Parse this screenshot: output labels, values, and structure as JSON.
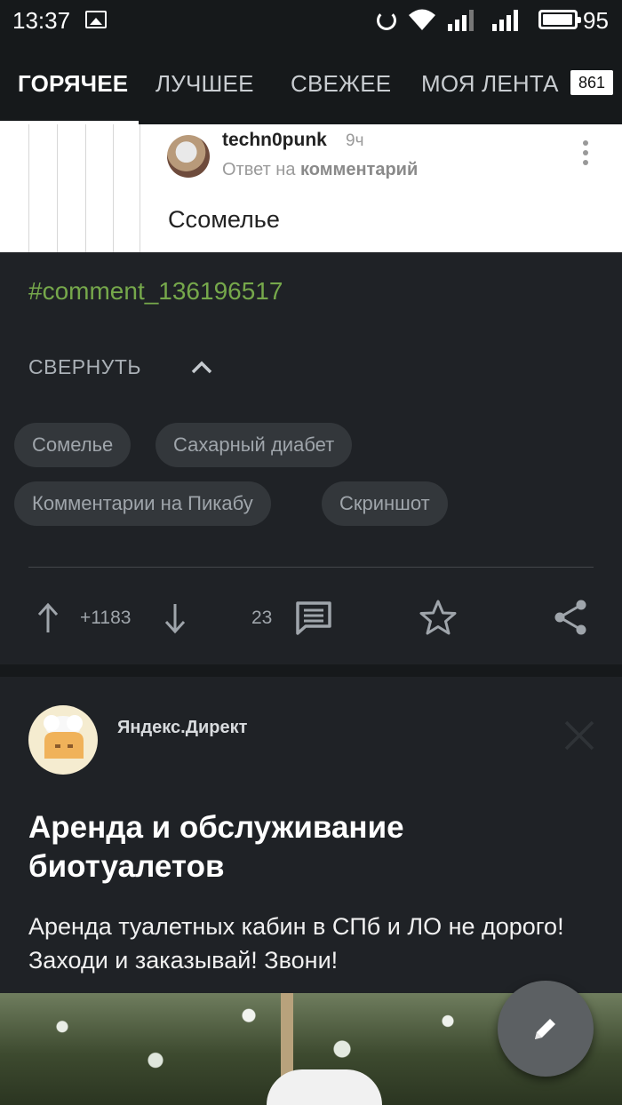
{
  "status_bar": {
    "time": "13:37",
    "battery_percent": "95",
    "icons": [
      "image-icon",
      "sync-icon",
      "wifi-icon",
      "signal-icon",
      "signal-icon",
      "battery-icon"
    ]
  },
  "tabs": [
    {
      "label": "ГОРЯЧЕЕ",
      "active": true
    },
    {
      "label": "ЛУЧШЕЕ",
      "active": false
    },
    {
      "label": "СВЕЖЕЕ",
      "active": false
    },
    {
      "label": "МОЯ ЛЕНТА",
      "active": false
    }
  ],
  "feed_badge": "861",
  "comment": {
    "author": "techn0punk",
    "time": "9ч",
    "reply_prefix": "Ответ на",
    "reply_link": "комментарий",
    "text": "Ссомелье"
  },
  "post": {
    "hashtag": "#comment_136196517",
    "collapse_label": "СВЕРНУТЬ",
    "tags": [
      "Сомелье",
      "Сахарный диабет",
      "Комментарии на Пикабу",
      "Скриншот"
    ],
    "rating": "+1183",
    "comments_count": "23"
  },
  "ad": {
    "source": "Яндекс.Директ",
    "title": "Аренда и обслуживание биотуалетов",
    "description": "Аренда туалетных кабин в СПб и ЛО не дорого! Заходи и заказывай! Звони!"
  },
  "colors": {
    "background": "#1f2226",
    "header": "#16191b",
    "hashtag": "#76a84b",
    "tag_bg": "#33373b"
  }
}
